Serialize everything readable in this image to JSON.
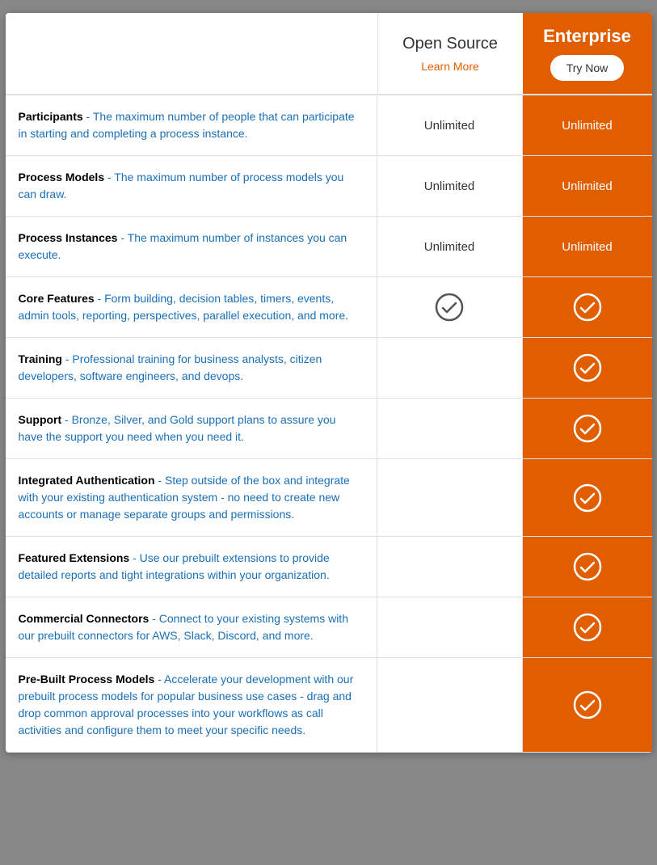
{
  "header": {
    "opensource_title": "Open Source",
    "enterprise_title": "Enterprise",
    "learn_more": "Learn More",
    "try_now": "Try Now"
  },
  "rows": [
    {
      "feature_title": "Participants",
      "feature_desc": " - The maximum number of people that can participate in starting and completing a process instance.",
      "opensource_value": "Unlimited",
      "opensource_type": "text",
      "enterprise_value": "Unlimited",
      "enterprise_type": "text"
    },
    {
      "feature_title": "Process Models",
      "feature_desc": " - The maximum number of process models you can draw.",
      "opensource_value": "Unlimited",
      "opensource_type": "text",
      "enterprise_value": "Unlimited",
      "enterprise_type": "text"
    },
    {
      "feature_title": "Process Instances",
      "feature_desc": " - The maximum number of instances you can execute.",
      "opensource_value": "Unlimited",
      "opensource_type": "text",
      "enterprise_value": "Unlimited",
      "enterprise_type": "text"
    },
    {
      "feature_title": "Core Features",
      "feature_desc": " - Form building, decision tables, timers, events, admin tools, reporting, perspectives, parallel execution, and more.",
      "opensource_value": "check",
      "opensource_type": "check",
      "enterprise_value": "check",
      "enterprise_type": "check"
    },
    {
      "feature_title": "Training",
      "feature_desc": " - Professional training for business analysts, citizen developers, software engineers, and devops.",
      "opensource_value": "",
      "opensource_type": "empty",
      "enterprise_value": "check",
      "enterprise_type": "check"
    },
    {
      "feature_title": "Support",
      "feature_desc": " - Bronze, Silver, and Gold support plans to assure you have the support you need when you need it.",
      "opensource_value": "",
      "opensource_type": "empty",
      "enterprise_value": "check",
      "enterprise_type": "check"
    },
    {
      "feature_title": "Integrated Authentication",
      "feature_desc": " - Step outside of the box and integrate with your existing authentication system - no need to create new accounts or manage separate groups and permissions.",
      "opensource_value": "",
      "opensource_type": "empty",
      "enterprise_value": "check",
      "enterprise_type": "check"
    },
    {
      "feature_title": "Featured Extensions",
      "feature_desc": " - Use our prebuilt extensions to provide detailed reports and tight integrations within your organization.",
      "opensource_value": "",
      "opensource_type": "empty",
      "enterprise_value": "check",
      "enterprise_type": "check"
    },
    {
      "feature_title": "Commercial Connectors",
      "feature_desc": " - Connect to your existing systems with our prebuilt connectors for AWS, Slack, Discord, and more.",
      "opensource_value": "",
      "opensource_type": "empty",
      "enterprise_value": "check",
      "enterprise_type": "check"
    },
    {
      "feature_title": "Pre-Built Process Models",
      "feature_desc": " - Accelerate your development with our prebuilt process models for popular business use cases - drag and drop common approval processes into your workflows as call activities and configure them to meet your specific needs.",
      "opensource_value": "",
      "opensource_type": "empty",
      "enterprise_value": "check",
      "enterprise_type": "check"
    }
  ]
}
